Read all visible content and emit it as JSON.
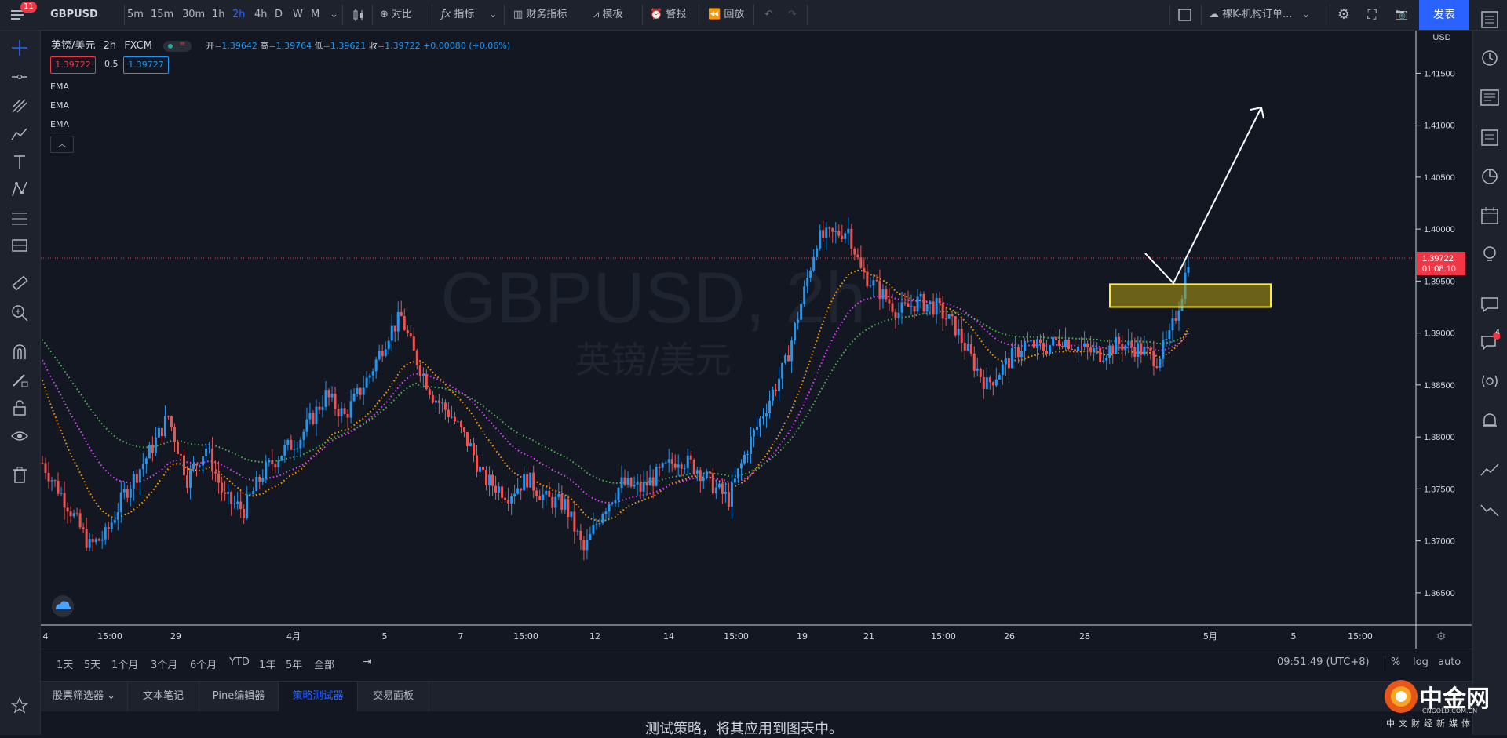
{
  "top": {
    "notification_count": "11",
    "symbol": "GBPUSD",
    "intervals": [
      "5m",
      "15m",
      "30m",
      "1h",
      "2h",
      "4h",
      "D",
      "W",
      "M"
    ],
    "active_interval": "2h",
    "compare": "对比",
    "indicators": "指标",
    "financials": "财务指标",
    "templates": "模板",
    "alert": "警报",
    "replay": "回放",
    "layout_name": "裸K-机构订单...",
    "publish": "发表"
  },
  "legend": {
    "title": "英镑/美元 · 2h · FXCM",
    "title_name": "英镑/美元",
    "title_interval": "2h",
    "title_source": "FXCM",
    "open_label": "开",
    "open_value": "=1.39642",
    "high_label": "高",
    "high_value": "=1.39764",
    "low_label": "低",
    "low_value": "=1.39621",
    "close_label": "收",
    "close_value": "=1.39722",
    "change": "+0.00080 (+0.06%)",
    "bid": "1.39722",
    "spread": "0.5",
    "ask": "1.39727",
    "indicators": [
      "EMA",
      "EMA",
      "EMA"
    ]
  },
  "watermark": {
    "symbol": "GBPUSD, 2h",
    "name": "英镑/美元"
  },
  "price_axis": {
    "currency": "USD",
    "last_price": "1.39722",
    "countdown": "01:08:10"
  },
  "chart_data": {
    "type": "candlestick",
    "y_ticks": [
      "1.41500",
      "1.41000",
      "1.40500",
      "1.40000",
      "1.39500",
      "1.39000",
      "1.38500",
      "1.38000",
      "1.37500",
      "1.37000",
      "1.36500"
    ],
    "ylim": [
      1.3625,
      1.4185
    ],
    "x_ticks": [
      "4",
      "15:00",
      "29",
      "4月",
      "5",
      "7",
      "15:00",
      "12",
      "14",
      "15:00",
      "19",
      "21",
      "15:00",
      "26",
      "28",
      "5月",
      "5",
      "15:00"
    ],
    "last_price": 1.39722,
    "series": [
      {
        "name": "EMA",
        "color": "#ff9800"
      },
      {
        "name": "EMA",
        "color": "#e040fb"
      },
      {
        "name": "EMA",
        "color": "#4caf50"
      }
    ],
    "zone": {
      "low": 1.3925,
      "high": 1.3947,
      "color": "#ffeb3b"
    },
    "colors": {
      "up": "#2196f3",
      "down": "#ef5350"
    }
  },
  "bottom": {
    "ranges": [
      "1天",
      "5天",
      "1个月",
      "3个月",
      "6个月",
      "YTD",
      "1年",
      "5年",
      "全部"
    ],
    "time": "09:51:49 (UTC+8)",
    "percent": "%",
    "log": "log",
    "auto": "auto"
  },
  "panels": {
    "tabs": [
      "股票筛选器",
      "文本笔记",
      "Pine编辑器",
      "策略测试器",
      "交易面板"
    ],
    "active": "策略测试器",
    "message": "测试策略，将其应用到图表中。"
  },
  "overlay_logo": {
    "brand": "中金网",
    "domain": "CNGOLD.COM.CN",
    "slogan": "中文财经新媒体"
  }
}
